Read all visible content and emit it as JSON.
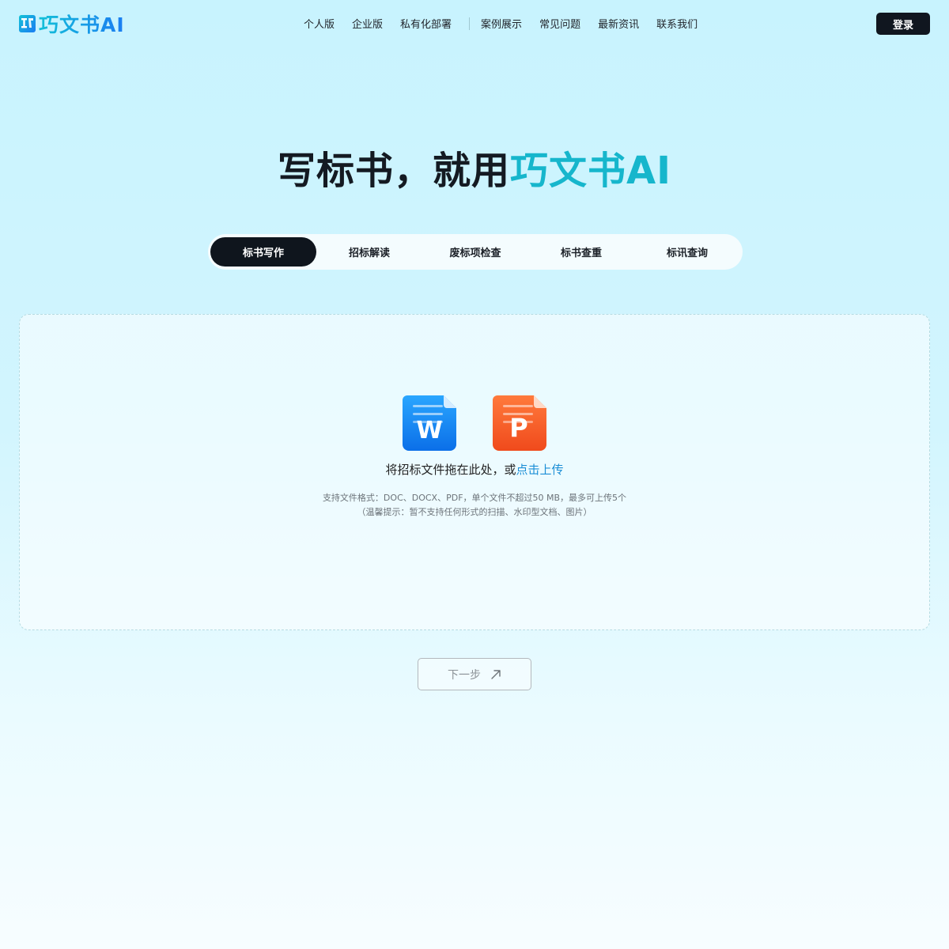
{
  "brand": {
    "name": "巧文书AI",
    "accent": "#16b6cc"
  },
  "nav": {
    "items": [
      "个人版",
      "企业版",
      "私有化部署",
      "案例展示",
      "常见问题",
      "最新资讯",
      "联系我们"
    ],
    "login_label": "登录"
  },
  "hero": {
    "prefix": "写标书，就用",
    "highlight": "巧文书AI"
  },
  "tabs": {
    "items": [
      "标书写作",
      "招标解读",
      "废标项检查",
      "标书查重",
      "标讯查询"
    ],
    "active": "标书写作"
  },
  "upload": {
    "icons": [
      "word-file-icon",
      "pdf-file-icon"
    ],
    "word_letter": "W",
    "pdf_letter": "P",
    "text": "将招标文件拖在此处，或",
    "link": "点击上传",
    "hint1": "支持文件格式：DOC、DOCX、PDF，单个文件不超过50 MB，最多可上传5个",
    "hint2": "（温馨提示：暂不支持任何形式的扫描、水印型文档、图片）"
  },
  "next_button": {
    "label": "下一步",
    "icon": "arrow-up-right-icon"
  }
}
